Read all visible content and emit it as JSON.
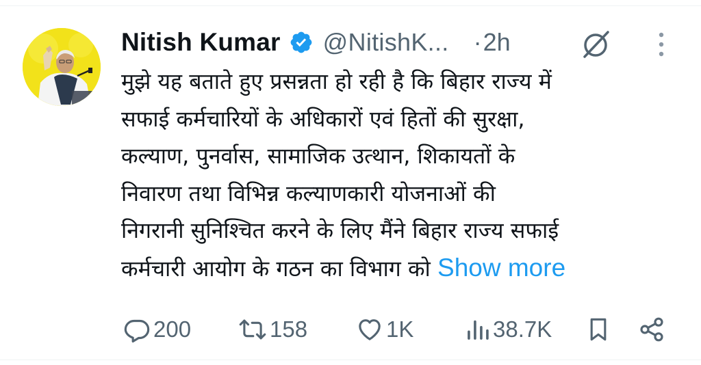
{
  "author": {
    "display_name": "Nitish Kumar",
    "handle": "@NitishK...",
    "time_separator": "·",
    "time": "2h",
    "verified_color": "#1d9bf0",
    "avatar_background": "#f2e21a"
  },
  "icons": {
    "avatar": "avatar-photo",
    "verified": "verified-badge-icon",
    "grok": "grok-icon",
    "more": "more-options-icon",
    "reply": "reply-icon",
    "retweet": "retweet-icon",
    "like": "heart-icon",
    "views": "views-icon",
    "bookmark": "bookmark-icon",
    "share": "share-icon"
  },
  "tweet": {
    "lines": [
      "मुझे यह बताते हुए प्रसन्नता हो रही है कि बिहार राज्य में",
      "सफाई कर्मचारियों के अधिकारों एवं हितों की सुरक्षा,",
      "कल्याण, पुनर्वास, सामाजिक उत्थान, शिकायतों के",
      "निवारण तथा विभिन्न कल्याणकारी योजनाओं की",
      "निगरानी सुनिश्चित करने के लिए मैंने बिहार राज्य सफाई",
      "कर्मचारी आयोग के गठन का विभाग को"
    ],
    "show_more_label": "Show more",
    "link_color": "#1d9bf0"
  },
  "actions": {
    "reply_count": "200",
    "retweet_count": "158",
    "like_count": "1K",
    "views_count": "38.7K"
  },
  "colors": {
    "text": "#0f1419",
    "secondary": "#536471",
    "divider": "#eff3f4"
  }
}
